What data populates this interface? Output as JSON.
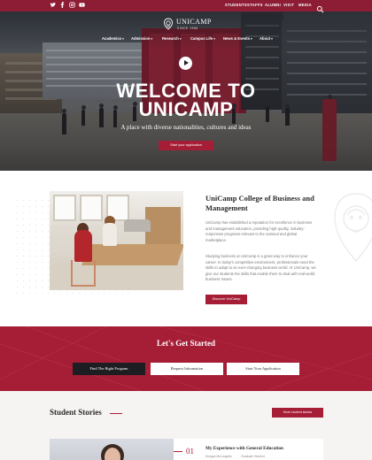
{
  "topbar": {
    "social": [
      {
        "icon": "twitter-icon",
        "glyph": "𝕥"
      },
      {
        "icon": "facebook-icon",
        "glyph": "f"
      },
      {
        "icon": "instagram-icon",
        "glyph": "◎"
      },
      {
        "icon": "youtube-icon",
        "glyph": "▶"
      }
    ],
    "links": [
      "STUDENTS",
      "STAFFS",
      "ALUMNI",
      "VISIT",
      "MEDIA"
    ],
    "search_icon": "search-icon"
  },
  "brand": {
    "name": "UNICAMP",
    "tagline": "SINCE 1966",
    "color": "#a61d36"
  },
  "nav": [
    "Academics",
    "Admission",
    "Research",
    "Campus Life",
    "News & Events",
    "About"
  ],
  "hero": {
    "title_line1": "WELCOME TO",
    "title_line2": "UNICAMP",
    "subtitle": "A place with diverse nationalities, cultures and ideas",
    "cta": "Start your application"
  },
  "about": {
    "title": "UniCamp College of Business and Management",
    "paragraph1": "UniCamp has established a reputation for excellence in business and management education, providing high-quality, industry-responsive programs relevant to the national and global marketplace.",
    "paragraph2": "Studying business at UniCamp is a great way to enhance your career. In today's competitive environment, professionals need the skills to adapt to an ever-changing business world. At UniCamp, we give our students the skills that enable them to deal with real-world business issues.",
    "cta": "Discover UniCamp"
  },
  "get_started": {
    "title": "Let's Get Started",
    "buttons": [
      "Find The Right Program",
      "Request Information",
      "Start Your Application"
    ]
  },
  "stories": {
    "title": "Student Stories",
    "more_button": "More student stories",
    "card": {
      "number": "01",
      "title": "My Experience with General Education",
      "author": "Morgan McLaughlin",
      "role": "Graduate Student"
    }
  }
}
